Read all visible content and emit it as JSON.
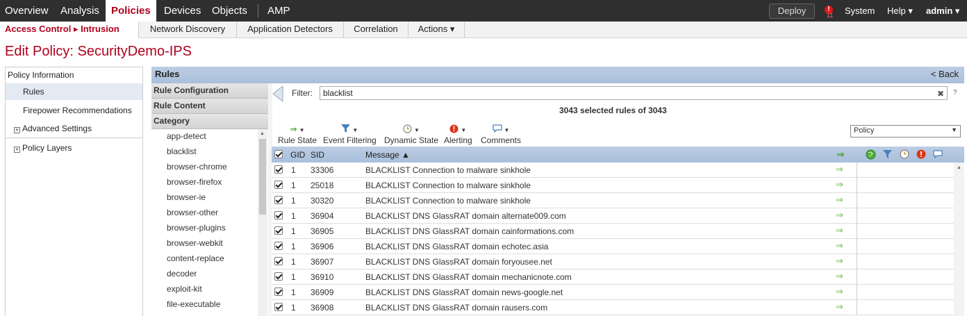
{
  "topnav": {
    "items": [
      "Overview",
      "Analysis",
      "Policies",
      "Devices",
      "Objects",
      "AMP"
    ],
    "deploy": "Deploy",
    "alert_count": "11",
    "system": "System",
    "help": "Help ▾",
    "user": "admin ▾"
  },
  "subnav": {
    "crumb": "Access Control ▸ Intrusion",
    "tabs": [
      "Network Discovery",
      "Application Detectors",
      "Correlation",
      "Actions ▾"
    ]
  },
  "page_title": "Edit Policy: SecurityDemo-IPS",
  "left": {
    "policy_info": "Policy Information",
    "rules": "Rules",
    "firepower_recs": "Firepower Recommendations",
    "advanced": "Advanced Settings",
    "policy_layers": "Policy Layers"
  },
  "rules_panel": {
    "title": "Rules",
    "back": "< Back",
    "rule_config": "Rule Configuration",
    "rule_content": "Rule Content",
    "category": "Category",
    "categories": [
      "app-detect",
      "blacklist",
      "browser-chrome",
      "browser-firefox",
      "browser-ie",
      "browser-other",
      "browser-plugins",
      "browser-webkit",
      "content-replace",
      "decoder",
      "exploit-kit",
      "file-executable"
    ]
  },
  "filter": {
    "label": "Filter:",
    "value": "blacklist",
    "clear": "✖",
    "help": "?"
  },
  "selected_count": "3043 selected rules of 3043",
  "toolbar": {
    "rule_state": "Rule State",
    "event_filtering": "Event Filtering",
    "dynamic_state": "Dynamic State",
    "alerting": "Alerting",
    "comments": "Comments",
    "policy_select": "Policy"
  },
  "table": {
    "headers": {
      "gid": "GID",
      "sid": "SID",
      "message": "Message ▲"
    },
    "rows": [
      {
        "gid": "1",
        "sid": "33306",
        "message": "BLACKLIST Connection to malware sinkhole"
      },
      {
        "gid": "1",
        "sid": "25018",
        "message": "BLACKLIST Connection to malware sinkhole"
      },
      {
        "gid": "1",
        "sid": "30320",
        "message": "BLACKLIST Connection to malware sinkhole"
      },
      {
        "gid": "1",
        "sid": "36904",
        "message": "BLACKLIST DNS GlassRAT domain alternate009.com"
      },
      {
        "gid": "1",
        "sid": "36905",
        "message": "BLACKLIST DNS GlassRAT domain cainformations.com"
      },
      {
        "gid": "1",
        "sid": "36906",
        "message": "BLACKLIST DNS GlassRAT domain echotec.asia"
      },
      {
        "gid": "1",
        "sid": "36907",
        "message": "BLACKLIST DNS GlassRAT domain foryousee.net"
      },
      {
        "gid": "1",
        "sid": "36910",
        "message": "BLACKLIST DNS GlassRAT domain mechanicnote.com"
      },
      {
        "gid": "1",
        "sid": "36909",
        "message": "BLACKLIST DNS GlassRAT domain news-google.net"
      },
      {
        "gid": "1",
        "sid": "36908",
        "message": "BLACKLIST DNS GlassRAT domain rausers.com"
      }
    ]
  },
  "colors": {
    "brand_red": "#b0001e",
    "header_blue": "#a9bfdc",
    "state_green": "#6cc04a"
  }
}
